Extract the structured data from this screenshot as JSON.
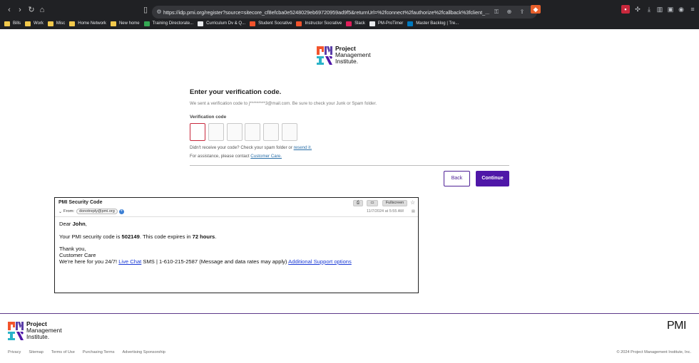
{
  "browser": {
    "url": "https://idp.pmi.org/register?source=sitecore_cf8efcba0e5248029eb69720959ad9f5&returnUrl=%2fconnect%2fauthorize%2fcallback%3fclient_...",
    "bookmarks": [
      {
        "label": "Bills",
        "icon": "folder-icon"
      },
      {
        "label": "Work",
        "icon": "folder-icon"
      },
      {
        "label": "Misc",
        "icon": "folder-icon"
      },
      {
        "label": "Home Network",
        "icon": "folder-icon"
      },
      {
        "label": "New home",
        "icon": "folder-icon"
      },
      {
        "label": "Training Directorate...",
        "icon": "drive-icon"
      },
      {
        "label": "Curriculum Dv & Q...",
        "icon": "doc-icon"
      },
      {
        "label": "Student Socrative",
        "icon": "socrative-icon"
      },
      {
        "label": "Instructor Socrative",
        "icon": "socrative-icon"
      },
      {
        "label": "Slack",
        "icon": "slack-icon"
      },
      {
        "label": "PM-ProTimer",
        "icon": "page-icon"
      },
      {
        "label": "Master Backlog | Tre...",
        "icon": "trello-icon"
      }
    ]
  },
  "logo": {
    "line1": "Project",
    "line2": "Management",
    "line3": "Institute."
  },
  "verify": {
    "title": "Enter your verification code.",
    "sent_text": "We sent a verification code to j*********3@mail.com. Be sure to check your Junk or Spam folder.",
    "code_label": "Verification code",
    "resend_prefix": "Didn't receive your code? Check your spam folder or ",
    "resend_link": "resend it.",
    "assist_prefix": "For assistance, please contact ",
    "assist_link": "Customer Care."
  },
  "buttons": {
    "back": "Back",
    "continue": "Continue"
  },
  "email": {
    "subject": "PMI Security Code",
    "from_label": "From:",
    "from_address": "donotreply@pmi.org",
    "fullscreen": "Fullscreen",
    "date": "11/7/2024 at 5:55 AM",
    "greeting_prefix": "Dear ",
    "name": "John",
    "greeting_suffix": ",",
    "code_prefix": "Your PMI security code is ",
    "code": "502149",
    "code_middle": ". This code expires in ",
    "expiry": "72 hours",
    "code_suffix": ".",
    "thanks": "Thank you,",
    "signature": "Customer Care",
    "help_prefix": "We're here for you 24/7! ",
    "live_chat": "Live Chat",
    "help_middle": " SMS | 1-610-215-2587 (Message and data rates may apply) ",
    "support_link": "Additional Support options"
  },
  "footer": {
    "links": [
      "Privacy",
      "Sitemap",
      "Terms of Use",
      "Purchasing Terms",
      "Advertising Sponsorship"
    ],
    "copyright": "© 2024 Project Management Institute, Inc.",
    "wordmark": "PMI"
  },
  "colors": {
    "brand_purple": "#4f17a8",
    "error_red": "#c8283c",
    "link_blue": "#2a6fa8"
  }
}
